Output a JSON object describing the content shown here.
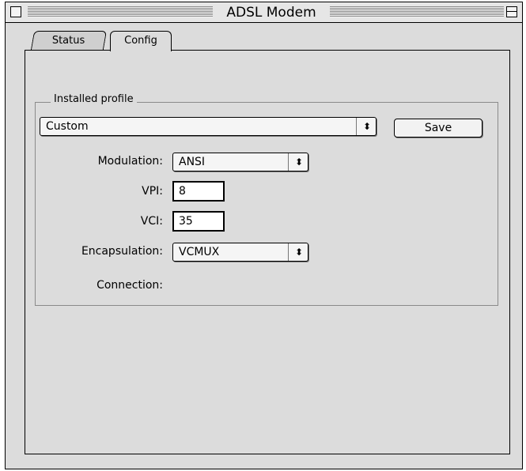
{
  "window": {
    "title": "ADSL Modem"
  },
  "tabs": [
    {
      "label": "Status",
      "selected": false
    },
    {
      "label": "Config",
      "selected": true
    }
  ],
  "group": {
    "label": "Installed profile",
    "profile_select": {
      "value": "Custom"
    },
    "save_button": "Save",
    "modulation": {
      "label": "Modulation:",
      "value": "ANSI"
    },
    "vpi": {
      "label": "VPI:",
      "value": "8"
    },
    "vci": {
      "label": "VCI:",
      "value": "35"
    },
    "encapsulation": {
      "label": "Encapsulation:",
      "value": "VCMUX"
    },
    "connection": {
      "label": "Connection:"
    }
  },
  "icons": {
    "popup_arrow": "⬍"
  }
}
